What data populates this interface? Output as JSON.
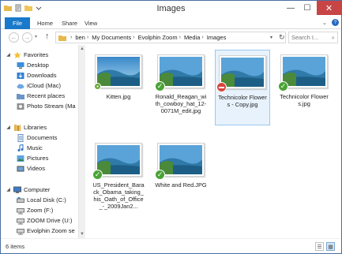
{
  "window": {
    "title": "Images",
    "minimize": "—",
    "maximize": "☐",
    "close": "✕"
  },
  "ribbon": {
    "file": "File",
    "tabs": [
      "Home",
      "Share",
      "View"
    ],
    "expand": "⌄",
    "help": "?"
  },
  "nav": {
    "back": "←",
    "forward": "→",
    "recent": "▾",
    "up": "↑",
    "breadcrumb": [
      "ben",
      "My Documents",
      "Evolphin Zoom",
      "Media",
      "Images"
    ],
    "address_dropdown": "▾",
    "refresh": "↻",
    "search_placeholder": "Search I...",
    "search_icon": "⌕"
  },
  "navpane": {
    "groups": [
      {
        "label": "Favorites",
        "icon": "star-icon",
        "expanded": true
      },
      {
        "label": "Libraries",
        "icon": "libraries-icon",
        "expanded": true
      },
      {
        "label": "Computer",
        "icon": "computer-icon",
        "expanded": true
      }
    ],
    "favorites": [
      "Desktop",
      "Downloads",
      "iCloud (Mac)",
      "Recent places",
      "Photo Stream (Ma"
    ],
    "libraries": [
      "Documents",
      "Music",
      "Pictures",
      "Videos"
    ],
    "computer": [
      "Local Disk (C:)",
      "Zoom (F:)",
      "ZOOM Drive (U:)",
      "Evolphin Zoom se"
    ]
  },
  "files": [
    {
      "name": "Kitten.jpg",
      "status": "synced",
      "selected": false
    },
    {
      "name": "Ronald_Reagan_with_cowboy_hat_12-0071M_edit.jpg",
      "status": "ok",
      "selected": false
    },
    {
      "name": "Technicolor Flowers - Copy.jpg",
      "status": "error",
      "selected": true
    },
    {
      "name": "Technicolor Flowers.jpg",
      "status": "ok",
      "selected": false
    },
    {
      "name": "US_President_Barack_Obama_taking_his_Oath_of_Office_-_2009Jan2...",
      "status": "ok",
      "selected": false
    },
    {
      "name": "White and Red.JPG",
      "status": "ok",
      "selected": false
    }
  ],
  "statusbar": {
    "item_count": "6 items",
    "details_view": "☰",
    "icons_view": "▦"
  },
  "colors": {
    "accent": "#1979ca",
    "ok": "#4aa336",
    "error": "#d6463d",
    "close": "#c74545"
  }
}
